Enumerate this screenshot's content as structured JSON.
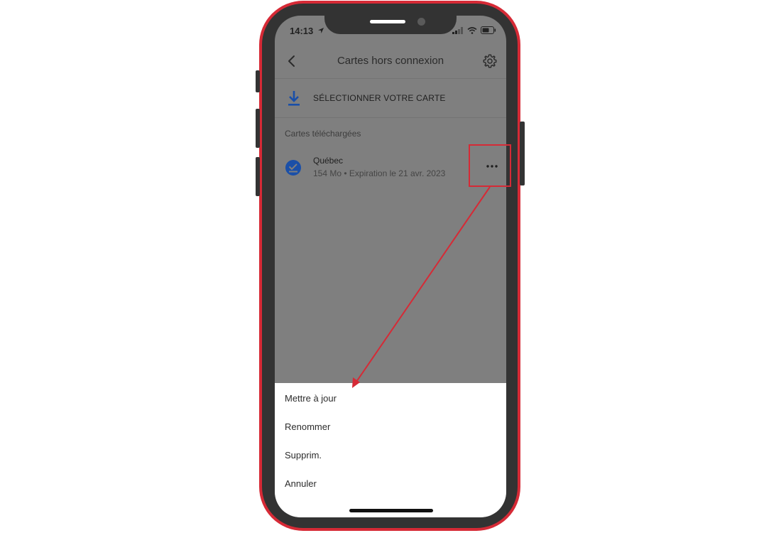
{
  "status_bar": {
    "time": "14:13"
  },
  "header": {
    "title": "Cartes hors connexion"
  },
  "select_map": {
    "label": "SÉLECTIONNER VOTRE CARTE"
  },
  "downloaded": {
    "section_label": "Cartes téléchargées",
    "items": [
      {
        "name": "Québec",
        "meta": "154 Mo • Expiration le 21 avr. 2023"
      }
    ]
  },
  "action_sheet": {
    "items": [
      {
        "label": "Mettre à jour"
      },
      {
        "label": "Renommer"
      },
      {
        "label": "Supprim."
      },
      {
        "label": "Annuler"
      }
    ]
  },
  "colors": {
    "annotation": "#d62a36",
    "accent_blue": "#1a57c8",
    "overlay_gray": "#7f7f7f"
  },
  "icons": [
    "back-arrow-icon",
    "gear-icon",
    "download-icon",
    "check-circle-icon",
    "more-horizontal-icon",
    "location-arrow-icon",
    "signal-icon",
    "wifi-icon",
    "battery-icon"
  ]
}
